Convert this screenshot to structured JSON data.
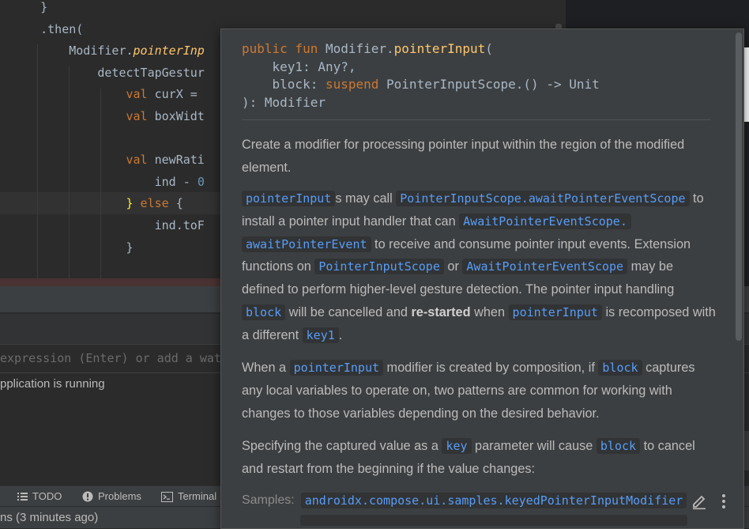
{
  "editor": {
    "lines": [
      {
        "indent": "    ",
        "tokens": [
          {
            "t": "}",
            "c": "plain"
          }
        ]
      },
      {
        "indent": "    ",
        "tokens": [
          {
            "t": ".then(",
            "c": "plain"
          }
        ]
      },
      {
        "indent": "        ",
        "tokens": [
          {
            "t": "Modifier.",
            "c": "plain"
          },
          {
            "t": "pointerInp",
            "c": "fn"
          }
        ]
      },
      {
        "indent": "            ",
        "tokens": [
          {
            "t": "detectTapGestur",
            "c": "plain"
          }
        ]
      },
      {
        "indent": "                ",
        "tokens": [
          {
            "t": "val ",
            "c": "kw"
          },
          {
            "t": "curX = ",
            "c": "plain"
          }
        ]
      },
      {
        "indent": "                ",
        "tokens": [
          {
            "t": "val ",
            "c": "kw"
          },
          {
            "t": "boxWidt",
            "c": "plain"
          }
        ]
      },
      {
        "indent": "",
        "tokens": []
      },
      {
        "indent": "                ",
        "tokens": [
          {
            "t": "val ",
            "c": "kw"
          },
          {
            "t": "newRati",
            "c": "plain"
          }
        ]
      },
      {
        "indent": "                    ",
        "tokens": [
          {
            "t": "ind - ",
            "c": "plain"
          },
          {
            "t": "0",
            "c": "num"
          }
        ]
      },
      {
        "indent": "                ",
        "tokens": [
          {
            "t": "}",
            "c": "brace"
          },
          {
            "t": " else ",
            "c": "kw"
          },
          {
            "t": "{",
            "c": "plain"
          }
        ]
      },
      {
        "indent": "                    ",
        "tokens": [
          {
            "t": "ind.toF",
            "c": "plain"
          }
        ]
      },
      {
        "indent": "                ",
        "tokens": [
          {
            "t": "}",
            "c": "plain"
          }
        ]
      }
    ]
  },
  "debug": {
    "eval_placeholder": "expression (Enter) or add a wat",
    "status_message": "pplication is running"
  },
  "toolbar": {
    "todo": "TODO",
    "problems": "Problems",
    "terminal": "Terminal"
  },
  "statusbar": {
    "text": "ns (3 minutes ago)"
  },
  "doc_popup": {
    "signature": {
      "line1": [
        "public ",
        "fun ",
        "Modifier.",
        "pointerInput",
        "("
      ],
      "line2": "    key1: Any?,",
      "line3_a": "    block: ",
      "line3_b": "suspend ",
      "line3_c": "PointerInputScope.() -> Unit",
      "line4": "): Modifier"
    },
    "p1": "Create a modifier for processing pointer input within the region of the modified element.",
    "p2": {
      "c1": "pointerInput",
      "t1": "s may call ",
      "c2": "PointerInputScope.awaitPointerEventScope",
      "t2": " to install a pointer input handler that can ",
      "c3": "AwaitPointerEventScope.",
      "c4": "awaitPointerEvent",
      "t3": " to receive and consume pointer input events. Extension functions on ",
      "c5": "PointerInputScope",
      "t4": " or ",
      "c6": "AwaitPointerEventScope",
      "t5": " may be defined to perform higher-level gesture detection. The pointer input handling ",
      "c7": "block",
      "t6": " will be cancelled and ",
      "b1": "re-started",
      "t7": " when ",
      "c8": "pointerInput",
      "t8": " is recomposed with a different ",
      "c9": "key1",
      "t9": "."
    },
    "p3": {
      "t1": "When a ",
      "c1": "pointerInput",
      "t2": " modifier is created by composition, if ",
      "c2": "block",
      "t3": " captures any local variables to operate on, two patterns are common for working with changes to those variables depending on the desired behavior."
    },
    "p4": {
      "t1": "Specifying the captured value as a ",
      "c1": "key",
      "t2": " parameter will cause ",
      "c2": "block",
      "t3": " to cancel and restart from the beginning if the value changes:"
    },
    "samples_label": "Samples:",
    "samples_link": "androidx.compose.ui.samples.keyedPointerInputModifier"
  },
  "colors": {
    "keyword": "#cc7832",
    "function": "#ffc66d",
    "number": "#6897bb",
    "code_link": "#589df6",
    "popup_bg": "#3c3f41",
    "editor_bg": "#2b2b2b"
  },
  "icons": {
    "todo": "list-icon",
    "problems": "exclamation-circle-icon",
    "terminal": "terminal-icon",
    "edit": "pencil-icon",
    "more": "vertical-dots-icon"
  }
}
